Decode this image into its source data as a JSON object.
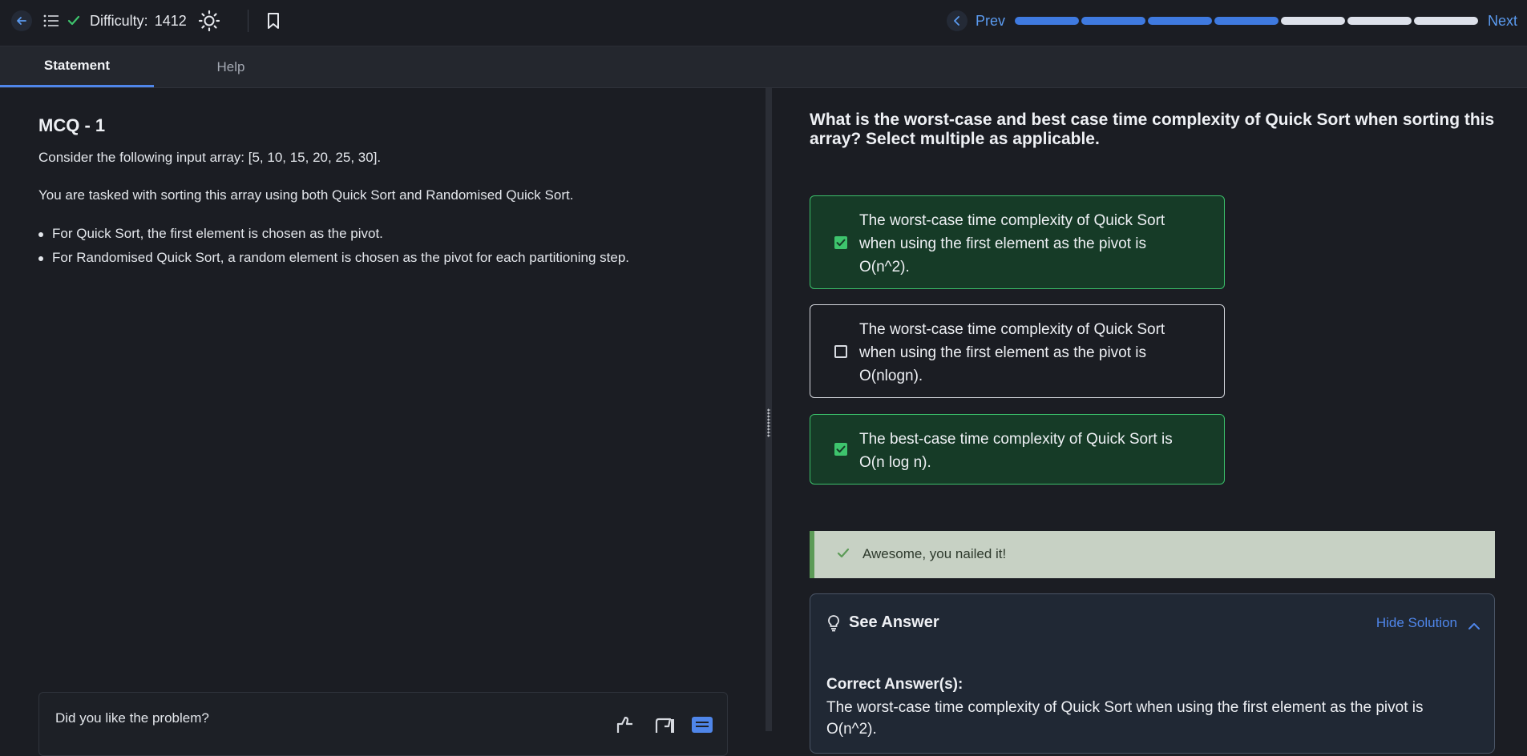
{
  "header": {
    "difficulty_label": "Difficulty:",
    "difficulty_value": "1412",
    "prev_label": "Prev",
    "next_label": "Next",
    "progress": {
      "total": 7,
      "completed": 4,
      "done_color": "#3f7ae0",
      "todo_color": "#dde1ea"
    },
    "icons": [
      "back-arrow-icon",
      "list-icon",
      "check-icon",
      "sun-icon",
      "bookmark-icon",
      "chevron-left-icon"
    ]
  },
  "tabs": [
    {
      "label": "Statement",
      "active": true
    },
    {
      "label": "Help",
      "active": false
    }
  ],
  "problem": {
    "title": "MCQ - 1",
    "paragraph_1": "Consider the following input array: [5, 10, 15, 20, 25, 30].",
    "paragraph_2": "You are tasked with sorting this array using both Quick Sort and Randomised Quick Sort.",
    "bullets": [
      "For Quick Sort, the first element is chosen as the pivot.",
      "For Randomised Quick Sort, a random element is chosen as the pivot for each partitioning step."
    ],
    "feedback_question": "Did you like the problem?"
  },
  "question": {
    "text": "What is the worst-case and best case time complexity of Quick Sort when sorting this array? Select multiple as applicable.",
    "options": [
      {
        "text": "The worst-case time complexity of Quick Sort when using the first element as the pivot is O(n^2).",
        "selected": true
      },
      {
        "text": "The worst-case time complexity of Quick Sort when using the first element as the pivot is O(nlogn).",
        "selected": false
      },
      {
        "text": "The best-case time complexity of Quick Sort is O(n log n).",
        "selected": true
      }
    ]
  },
  "result": {
    "message": "Awesome, you nailed it!"
  },
  "answer": {
    "title": "See Answer",
    "toggle_label": "Hide Solution",
    "correct_label": "Correct Answer(s):",
    "correct_text": "The worst-case time complexity of Quick Sort when using the first element as the pivot is O(n^2)."
  },
  "colors": {
    "accent": "#4f86ea",
    "success": "#3ec46d",
    "selected_bg": "#163b27",
    "background": "#1b1d23"
  }
}
